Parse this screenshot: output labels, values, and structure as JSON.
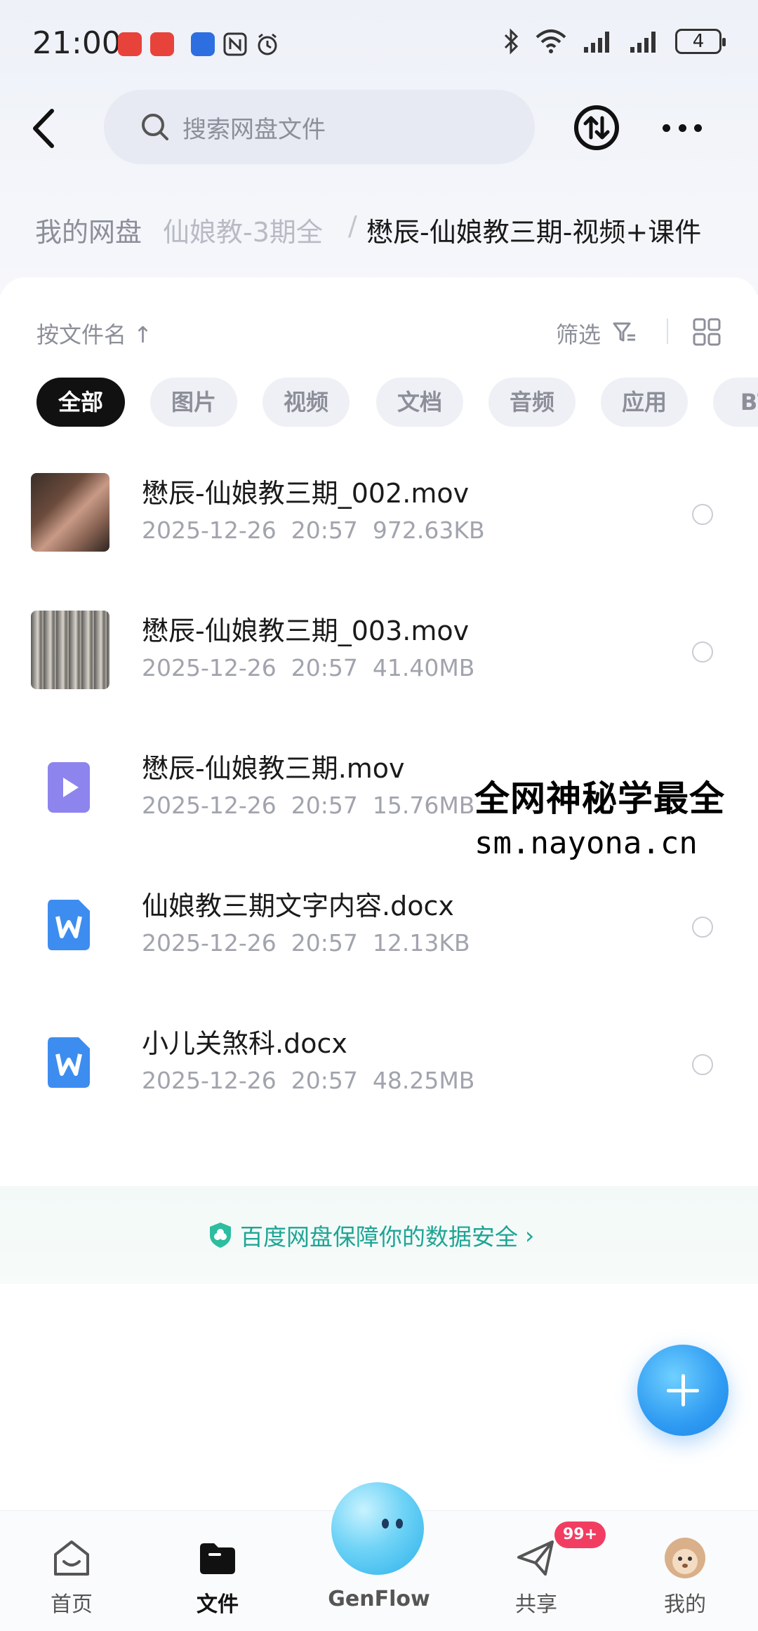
{
  "status_bar": {
    "time": "21:00",
    "battery": "4",
    "icons": [
      "huawei-app-icon",
      "huawei-app-icon",
      "security-app-icon",
      "nfc-icon",
      "alarm-icon",
      "bluetooth-icon",
      "wifi-icon",
      "signal-icon",
      "signal-icon",
      "battery-icon"
    ]
  },
  "header": {
    "search_placeholder": "搜索网盘文件",
    "icons": [
      "back-icon",
      "search-icon",
      "transfer-icon",
      "more-icon"
    ]
  },
  "breadcrumb": {
    "items": [
      "我的网盘",
      "仙娘教-3期全",
      "懋辰-仙娘教三期-视频+课件"
    ],
    "separator": "/"
  },
  "toolbar": {
    "sort_label": "按文件名 ↑",
    "filter_label": "筛选"
  },
  "chips": [
    "全部",
    "图片",
    "视频",
    "文档",
    "音频",
    "应用",
    "BT"
  ],
  "files": [
    {
      "name": "懋辰-仙娘教三期_002.mov",
      "date": "2025-12-26",
      "time": "20:57",
      "size": "972.63KB",
      "icon": "video-thumbnail"
    },
    {
      "name": "懋辰-仙娘教三期_003.mov",
      "date": "2025-12-26",
      "time": "20:57",
      "size": "41.40MB",
      "icon": "video-thumbnail"
    },
    {
      "name": "懋辰-仙娘教三期.mov",
      "date": "2025-12-26",
      "time": "20:57",
      "size": "15.76MB",
      "icon": "video-file-icon"
    },
    {
      "name": "仙娘教三期文字内容.docx",
      "date": "2025-12-26",
      "time": "20:57",
      "size": "12.13KB",
      "icon": "word-doc-icon"
    },
    {
      "name": "小儿关煞科.docx",
      "date": "2025-12-26",
      "time": "20:57",
      "size": "48.25MB",
      "icon": "word-doc-icon"
    }
  ],
  "watermark": {
    "line1": "全网神秘学最全",
    "line2": "sm.nayona.cn"
  },
  "security_banner": {
    "text": "百度网盘保障你的数据安全"
  },
  "bottom_nav": [
    {
      "label": "首页",
      "icon": "home-icon",
      "active": false
    },
    {
      "label": "文件",
      "icon": "folder-icon",
      "active": true
    },
    {
      "label": "GenFlow",
      "icon": "genflow-icon",
      "active": false
    },
    {
      "label": "共享",
      "icon": "share-icon",
      "active": false,
      "badge": "99+"
    },
    {
      "label": "我的",
      "icon": "avatar-icon",
      "active": false
    }
  ],
  "colors": {
    "accent": "#1ea595",
    "fab": "#2f9bf2",
    "badge": "#f23d62",
    "active_chip": "#111111"
  }
}
